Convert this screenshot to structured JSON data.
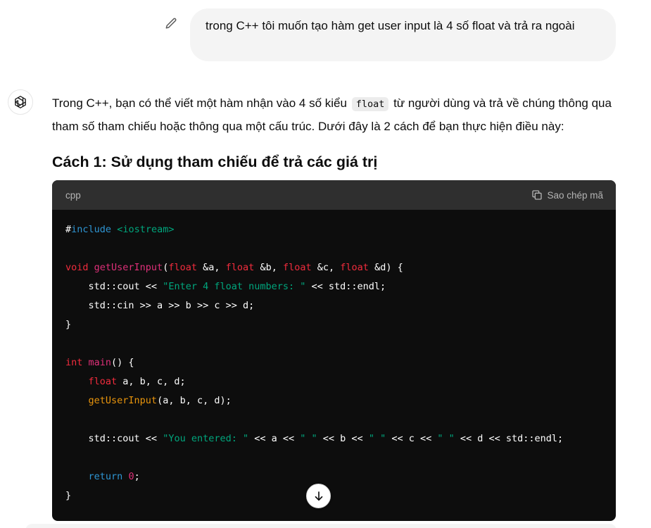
{
  "user_message": {
    "text": "trong C++ tôi muốn tạo hàm get user input là 4 số float và trả ra ngoài"
  },
  "assistant": {
    "intro_part1": "Trong C++, bạn có thể viết một hàm nhận vào 4 số kiểu",
    "intro_code": "float",
    "intro_part2": "từ người dùng và trả về chúng thông qua tham số tham chiếu hoặc thông qua một cấu trúc. Dưới đây là 2 cách để bạn thực hiện điều này:",
    "heading": "Cách 1: Sử dụng tham chiếu để trả các giá trị"
  },
  "code_block": {
    "language": "cpp",
    "copy_label": "Sao chép mã",
    "t": {
      "hash": "#",
      "include": "include",
      "iostream": "<iostream>",
      "void": "void",
      "fn_name": "getUserInput",
      "params": [
        {
          "type": "float",
          "name": "&a"
        },
        {
          "type": "float",
          "name": "&b"
        },
        {
          "type": "float",
          "name": "&c"
        },
        {
          "type": "float",
          "name": "&d"
        }
      ],
      "cout_prefix": "std::cout << ",
      "str_enter": "\"Enter 4 float numbers: \"",
      "endl_suffix": " << std::endl;",
      "cin_line": "std::cin >> a >> b >> c >> d;",
      "close_brace": "}",
      "int": "int",
      "main": "main",
      "main_open": "() {",
      "float": "float",
      "decl_vars": " a, b, c, d;",
      "call_args": "(a, b, c, d);",
      "str_entered": "\"You entered: \"",
      "out_a": " << a << ",
      "out_b": " << b << ",
      "out_c": " << c << ",
      "out_d": " << d << std::endl;",
      "space_str": "\" \"",
      "return": "return",
      "zero": "0",
      "semi": ";"
    }
  },
  "icons": {
    "edit": "pencil-icon",
    "avatar": "openai-logo-icon",
    "copy": "copy-icon",
    "scroll": "arrow-down-icon"
  }
}
